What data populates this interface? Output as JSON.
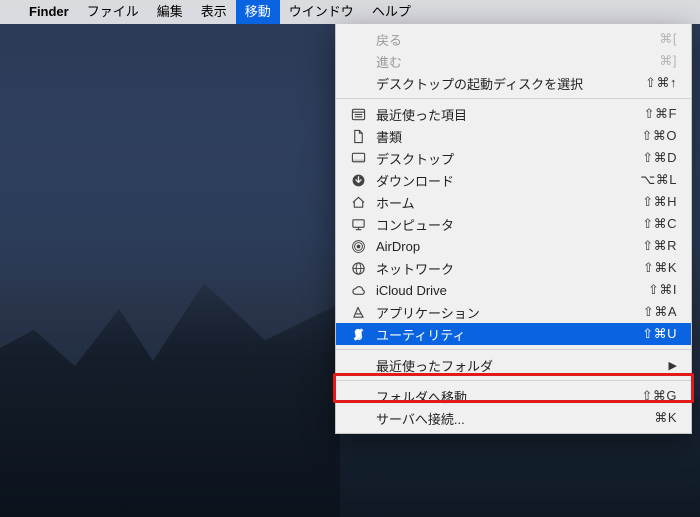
{
  "menubar": {
    "apple": "",
    "app": "Finder",
    "items": [
      "ファイル",
      "編集",
      "表示",
      "移動",
      "ウインドウ",
      "ヘルプ"
    ],
    "active_index": 3
  },
  "menu": {
    "back": {
      "label": "戻る",
      "shortcut": "⌘["
    },
    "forward": {
      "label": "進む",
      "shortcut": "⌘]"
    },
    "startup": {
      "label": "デスクトップの起動ディスクを選択",
      "shortcut": "⇧⌘↑"
    },
    "recents": {
      "label": "最近使った項目",
      "shortcut": "⇧⌘F"
    },
    "documents": {
      "label": "書類",
      "shortcut": "⇧⌘O"
    },
    "desktop": {
      "label": "デスクトップ",
      "shortcut": "⇧⌘D"
    },
    "downloads": {
      "label": "ダウンロード",
      "shortcut": "⌥⌘L"
    },
    "home": {
      "label": "ホーム",
      "shortcut": "⇧⌘H"
    },
    "computer": {
      "label": "コンピュータ",
      "shortcut": "⇧⌘C"
    },
    "airdrop": {
      "label": "AirDrop",
      "shortcut": "⇧⌘R"
    },
    "network": {
      "label": "ネットワーク",
      "shortcut": "⇧⌘K"
    },
    "icloud": {
      "label": "iCloud Drive",
      "shortcut": "⇧⌘I"
    },
    "applications": {
      "label": "アプリケーション",
      "shortcut": "⇧⌘A"
    },
    "utilities": {
      "label": "ユーティリティ",
      "shortcut": "⇧⌘U"
    },
    "recent_folders": {
      "label": "最近使ったフォルダ",
      "arrow": "▶"
    },
    "go_to_folder": {
      "label": "フォルダへ移動...",
      "shortcut": "⇧⌘G"
    },
    "connect": {
      "label": "サーバへ接続...",
      "shortcut": "⌘K"
    }
  }
}
